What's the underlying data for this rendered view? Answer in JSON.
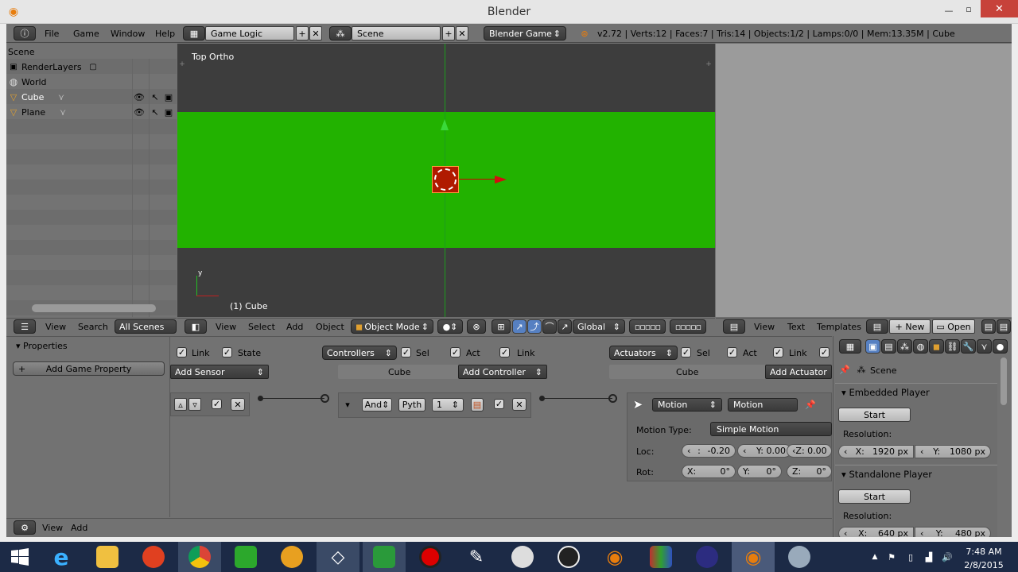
{
  "window": {
    "title": "Blender"
  },
  "top": {
    "menus": [
      "File",
      "Game",
      "Window",
      "Help"
    ],
    "screen_layout": "Game Logic",
    "scene": "Scene",
    "engine": "Blender Game",
    "stats": "v2.72 | Verts:12 | Faces:7 | Tris:14 | Objects:1/2 | Lamps:0/0 | Mem:13.35M | Cube"
  },
  "outliner": {
    "root": "Scene",
    "items": [
      "RenderLayers",
      "World",
      "Cube",
      "Plane"
    ],
    "footer": {
      "view": "View",
      "search": "Search",
      "filter": "All Scenes"
    }
  },
  "viewport": {
    "label": "Top Ortho",
    "object_label": "(1) Cube",
    "axis_y": "y",
    "header": {
      "view": "View",
      "select": "Select",
      "add": "Add",
      "object": "Object",
      "mode": "Object Mode",
      "orientation": "Global"
    }
  },
  "text_editor": {
    "header": {
      "view": "View",
      "text": "Text",
      "templates": "Templates",
      "new": "New",
      "open": "Open"
    }
  },
  "logic": {
    "properties_title": "Properties",
    "add_property": "Add Game Property",
    "sensors": {
      "link": "Link",
      "state": "State",
      "add": "Add Sensor"
    },
    "controllers": {
      "menu": "Controllers",
      "sel": "Sel",
      "act": "Act",
      "link": "Link",
      "object": "Cube",
      "add": "Add Controller",
      "type": "And",
      "pyth": "Pyth",
      "value": "1"
    },
    "actuators": {
      "menu": "Actuators",
      "sel": "Sel",
      "act": "Act",
      "link": "Link",
      "object": "Cube",
      "add": "Add Actuator",
      "type": "Motion",
      "name": "Motion",
      "motion_type_label": "Motion Type:",
      "motion_type": "Simple Motion",
      "loc_label": "Loc:",
      "loc": [
        "-0.20",
        "Y: 0.00",
        "Z: 0.00"
      ],
      "loc_x_prefix": ":",
      "rot_label": "Rot:",
      "rot": [
        "0°",
        "0°",
        "0°"
      ],
      "rot_prefix": [
        "X:",
        "Y:",
        "Z:"
      ]
    },
    "footer": {
      "view": "View",
      "add": "Add"
    }
  },
  "render_panel": {
    "scene": "Scene",
    "embedded": {
      "title": "Embedded Player",
      "start": "Start",
      "resolution": "Resolution:",
      "x": "1920 px",
      "y": "1080 px",
      "x_label": "X:",
      "y_label": "Y:"
    },
    "standalone": {
      "title": "Standalone Player",
      "start": "Start",
      "resolution": "Resolution:",
      "x": "640 px",
      "y": "480 px",
      "x_label": "X:",
      "y_label": "Y:"
    }
  },
  "taskbar": {
    "time": "7:48 AM",
    "date": "2/8/2015"
  },
  "colors": {
    "ground": "#22b200",
    "viewport_bg": "#3d3d3d",
    "cube": "#b01a00"
  }
}
